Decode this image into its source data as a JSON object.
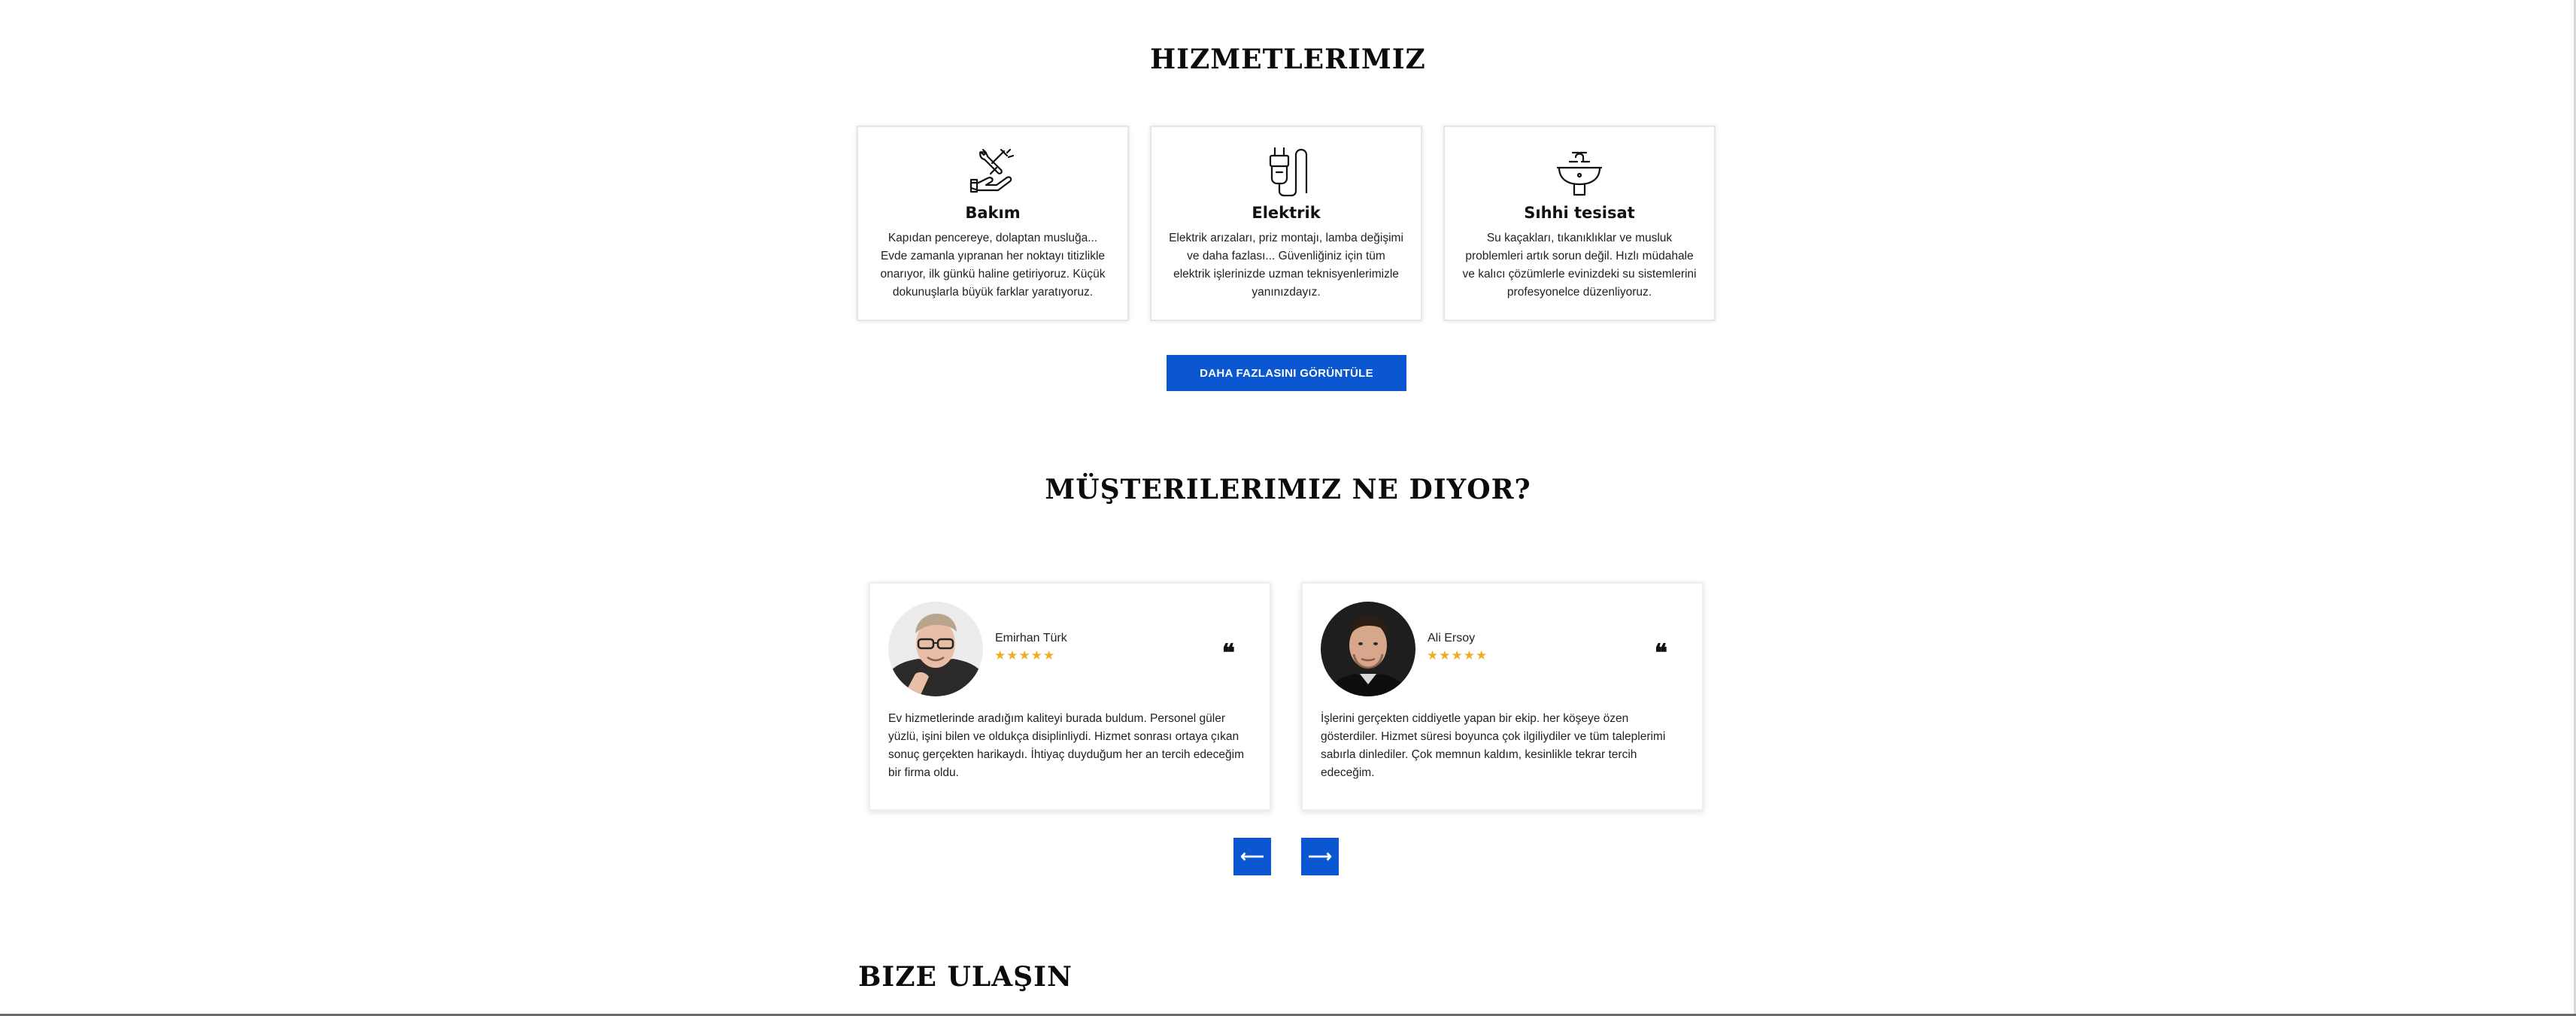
{
  "services": {
    "title": "HIZMETLERIMIZ",
    "items": [
      {
        "icon": "repair-tools-icon",
        "title": "Bakım",
        "description": "Kapıdan pencereye, dolaptan musluğa... Evde zamanla yıpranan her noktayı titizlikle onarıyor, ilk günkü haline getiriyoruz. Küçük dokunuşlarla büyük farklar yaratıyoruz."
      },
      {
        "icon": "electric-plug-icon",
        "title": "Elektrik",
        "description": "Elektrik arızaları, priz montajı, lamba değişimi ve daha fazlası... Güvenliğiniz için tüm elektrik işlerinizde uzman teknisyenlerimizle yanınızdayız."
      },
      {
        "icon": "sink-faucet-icon",
        "title": "Sıhhi tesisat",
        "description": "Su kaçakları, tıkanıklıklar ve musluk problemleri artık sorun değil. Hızlı müdahale ve kalıcı çözümlerle evinizdeki su sistemlerini profesyonelce düzenliyoruz."
      }
    ],
    "cta_label": "DAHA FAZLASINI GÖRÜNTÜLE"
  },
  "testimonials": {
    "title": "MÜŞTERILERIMIZ NE DIYOR?",
    "items": [
      {
        "name": "Emirhan Türk",
        "stars": "★★★★★",
        "rating": 5,
        "quote_icon": "❝",
        "text": "Ev hizmetlerinde aradığım kaliteyi burada buldum. Personel güler yüzlü, işini bilen ve oldukça disiplinliydi. Hizmet sonrası ortaya çıkan sonuç gerçekten harikaydı. İhtiyaç duyduğum her an tercih edeceğim bir firma oldu."
      },
      {
        "name": "Ali Ersoy",
        "stars": "★★★★★",
        "rating": 5,
        "quote_icon": "❝",
        "text": "İşlerini gerçekten ciddiyetle yapan bir ekip. her köşeye özen gösterdiler. Hizmet süresi boyunca çok ilgiliydiler ve tüm taleplerimi sabırla dinlediler. Çok memnun kaldım, kesinlikle tekrar tercih edeceğim."
      }
    ],
    "prev_label": "⟵",
    "next_label": "⟶"
  },
  "contact": {
    "title": "BIZE ULAŞIN"
  },
  "colors": {
    "accent": "#0a57d1",
    "stars": "#f0ad1f"
  }
}
